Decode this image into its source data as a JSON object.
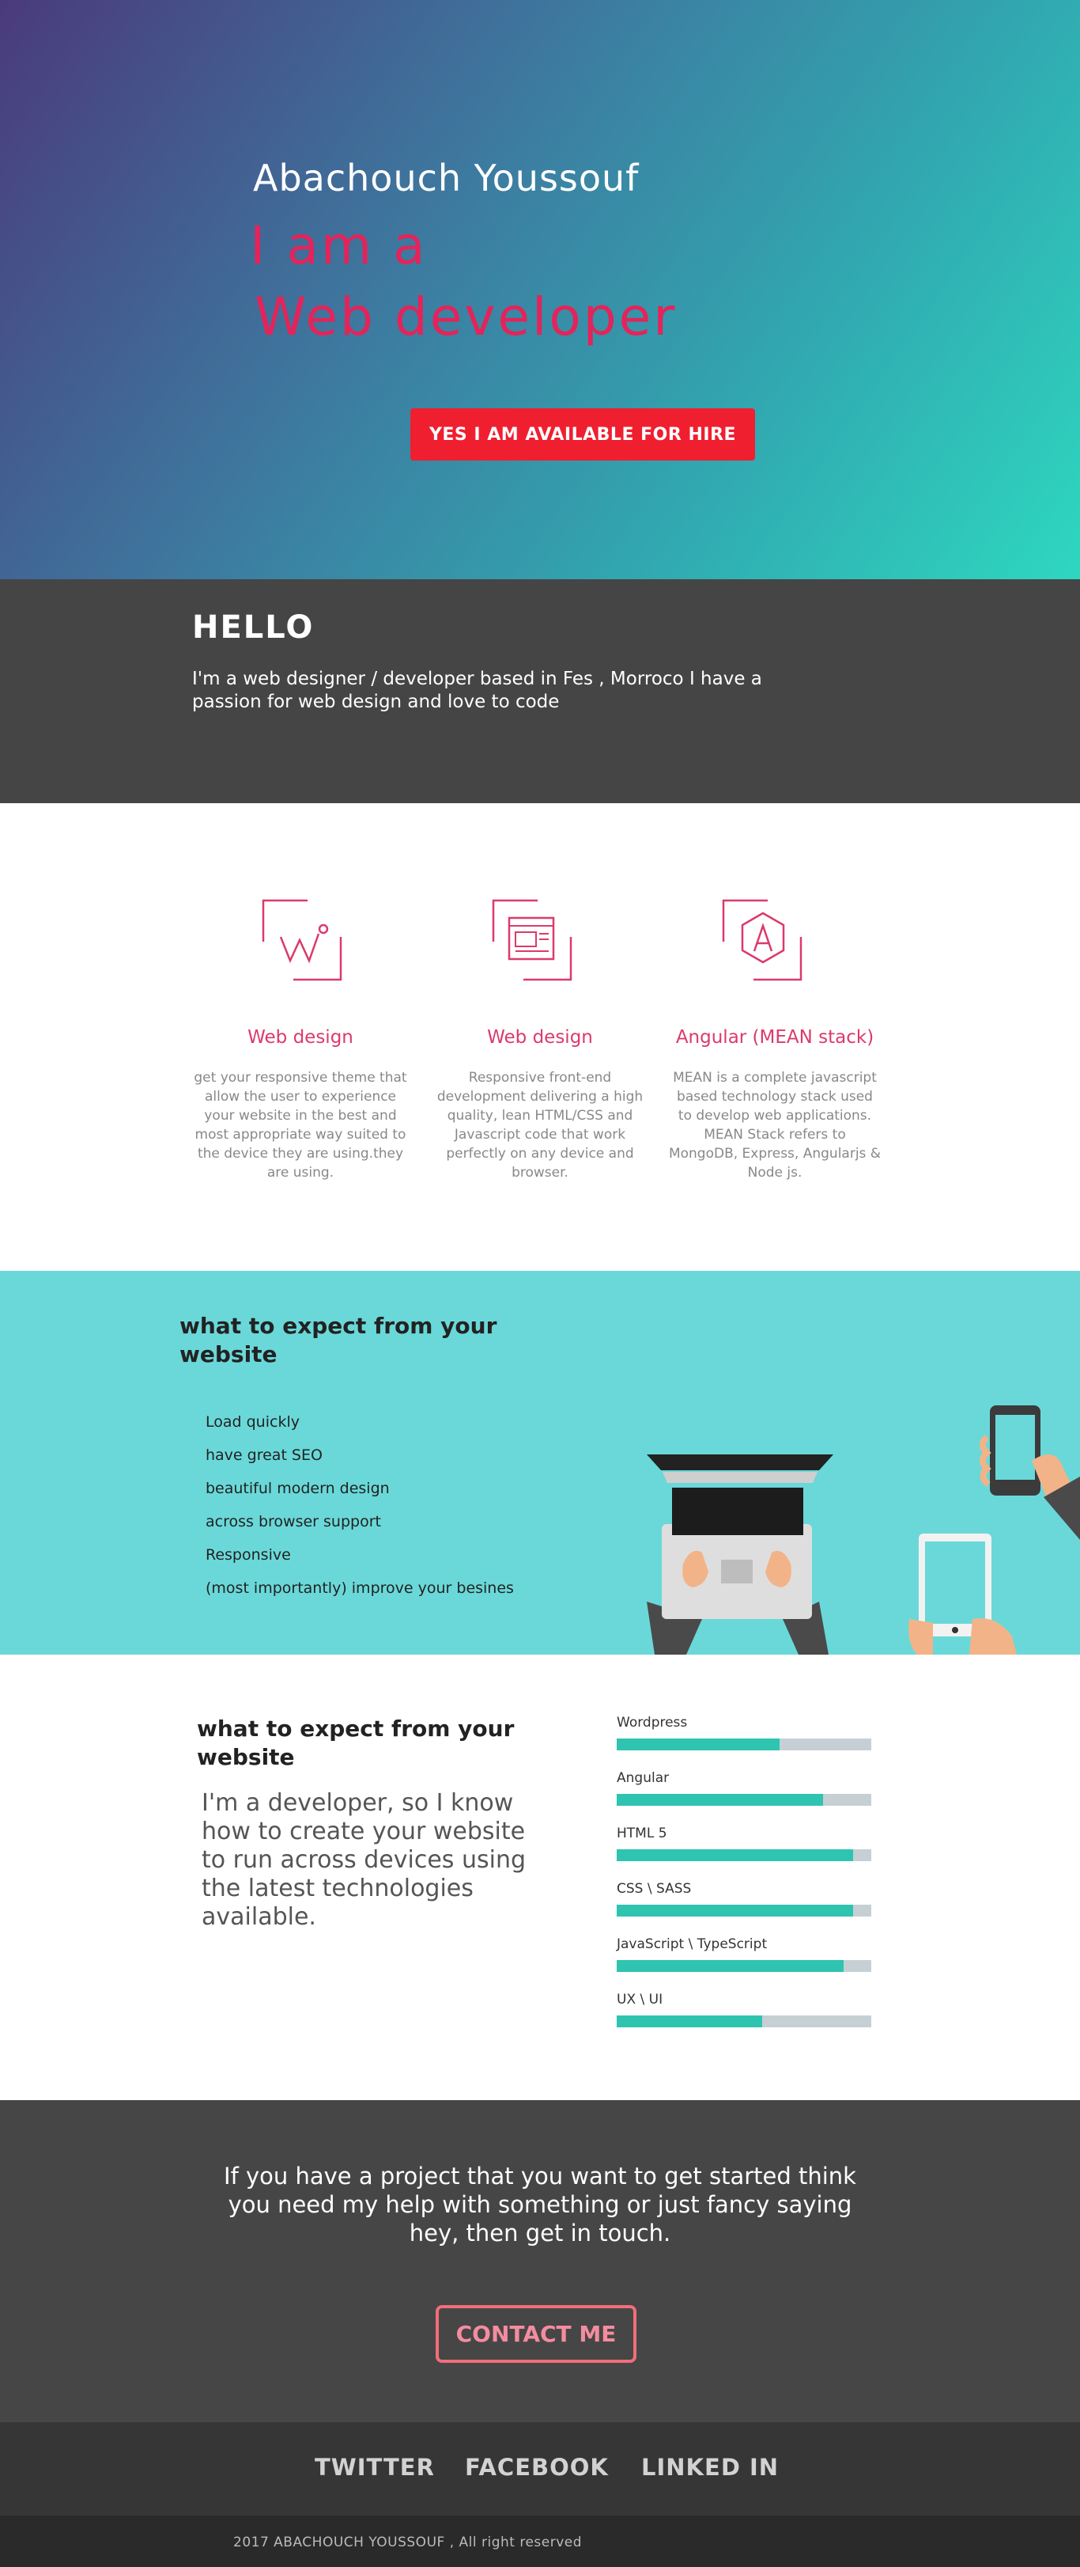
{
  "hero": {
    "name": "Abachouch Youssouf",
    "role_line1": "I am a",
    "role_line2": "Web developer",
    "hire_button": "YES I AM AVAILABLE FOR HIRE"
  },
  "hello": {
    "title": "HELLO",
    "text": "I'm a web designer / developer based in Fes , Morroco I have a passion for web design and love to code"
  },
  "services": [
    {
      "icon": "web-design-w-icon",
      "title": "Web design",
      "desc": "get your responsive theme that allow the user to experience your website in the best and most appropriate way suited to the device they are using.they are using."
    },
    {
      "icon": "browser-window-icon",
      "title": "Web design",
      "desc": "Responsive front-end development delivering a high quality, lean HTML/CSS and Javascript code that work perfectly on any device and browser."
    },
    {
      "icon": "angular-logo-icon",
      "title": "Angular (MEAN stack)",
      "desc": "MEAN is a complete javascript based technology stack used to develop web applications. MEAN Stack refers to MongoDB, Express, Angularjs & Node js."
    }
  ],
  "expect": {
    "title": "what to expect from your website",
    "items": [
      "Load quickly",
      "have great SEO",
      "beautiful modern design",
      "across browser support",
      "Responsive",
      "(most importantly) improve your besines"
    ]
  },
  "skills_section": {
    "title": "what to expect from your website",
    "text": "I'm a developer, so I know how to create your website to run across devices using the latest technologies available.",
    "skills": [
      {
        "label": "Wordpress",
        "level": 0.64
      },
      {
        "label": "Angular",
        "level": 0.81
      },
      {
        "label": "HTML 5",
        "level": 0.93
      },
      {
        "label": "CSS \\ SASS",
        "level": 0.93
      },
      {
        "label": "JavaScript \\ TypeScript",
        "level": 0.89
      },
      {
        "label": "UX \\ UI",
        "level": 0.57
      }
    ]
  },
  "contact": {
    "text": "If you have a project that you want to get started think you need my help with something or just fancy saying hey, then get in touch.",
    "button": "CONTACT ME"
  },
  "social": {
    "twitter": "TWITTER",
    "facebook": "FACEBOOK",
    "linkedin": "LINKED IN"
  },
  "footer": {
    "copyright": "2017 ABACHOUCH YOUSSOUF , All right reserved"
  },
  "colors": {
    "accent": "#e3245a",
    "hire_button": "#ef1f30",
    "teal": "#6ad8d9",
    "skill_fill": "#2ec4b0",
    "dark": "#454545"
  }
}
